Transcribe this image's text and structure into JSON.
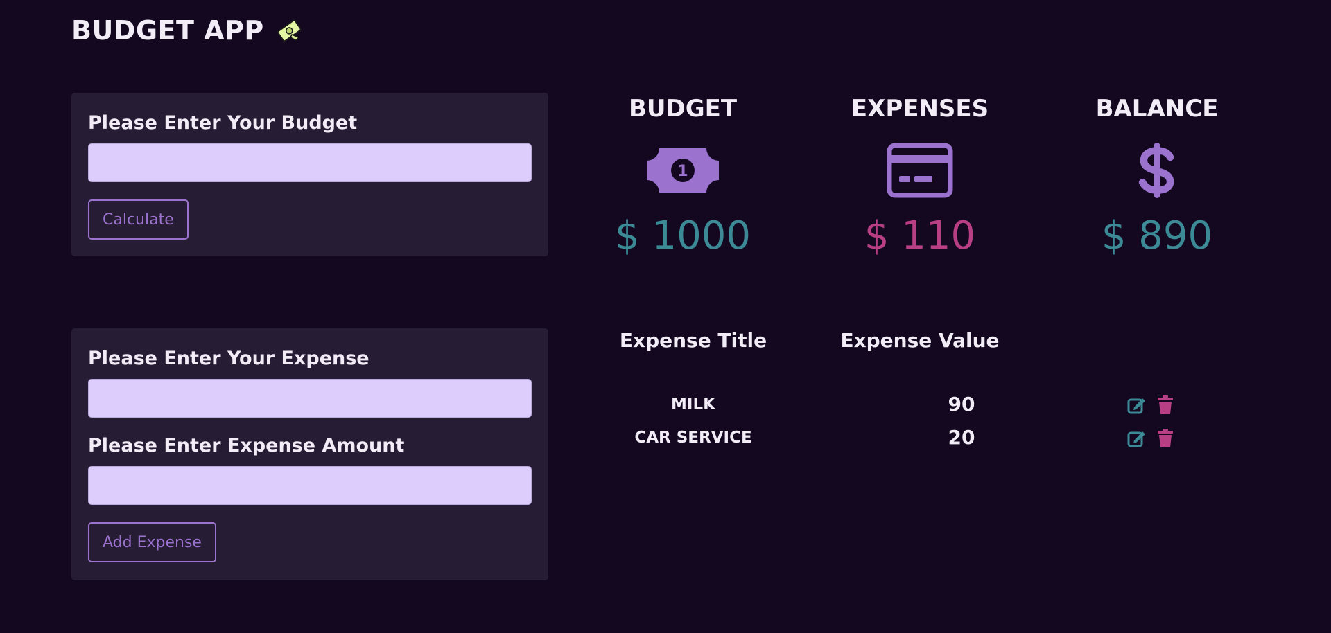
{
  "app": {
    "title": "BUDGET APP"
  },
  "budget_form": {
    "label": "Please Enter Your Budget",
    "input_value": "",
    "button_label": "Calculate"
  },
  "expense_form": {
    "title_label": "Please Enter Your Expense",
    "title_value": "",
    "amount_label": "Please Enter Expense Amount",
    "amount_value": "",
    "button_label": "Add Expense"
  },
  "summary": {
    "budget": {
      "heading": "BUDGET",
      "value": "$ 1000",
      "icon": "money-bill-icon"
    },
    "expenses": {
      "heading": "EXPENSES",
      "value": "$ 110",
      "icon": "credit-card-icon"
    },
    "balance": {
      "heading": "BALANCE",
      "value": "$ 890",
      "icon": "dollar-sign-icon"
    }
  },
  "table": {
    "headers": {
      "title": "Expense Title",
      "value": "Expense Value"
    },
    "rows": [
      {
        "title": "MILK",
        "value": "90"
      },
      {
        "title": "CAR SERVICE",
        "value": "20"
      }
    ]
  },
  "colors": {
    "background": "#130820",
    "card": "#261d34",
    "input": "#dccdfd",
    "accent_purple": "#9b73cf",
    "teal": "#3c8a96",
    "pink": "#b93f84"
  }
}
